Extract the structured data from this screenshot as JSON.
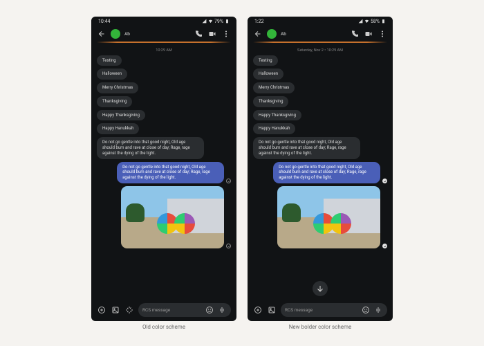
{
  "left": {
    "status": {
      "time": "10:44",
      "battery": "79%"
    },
    "header": {
      "contact_name": "Ab"
    },
    "timestamp": "10:29 AM",
    "incoming": [
      "Testing",
      "Halloween",
      "Merry Christmas",
      "Thanksgiving",
      "Happy Thanksgiving",
      "Happy Hanukkah",
      "Do not go gentle into that good night, Old age should burn and rave at close of day; Rage, rage against the dying of the light."
    ],
    "outgoing": "Do not go gentle into that good night, Old age should burn and rave at close of day; Rage, rage against the dying of the light.",
    "composer": {
      "placeholder": "RCS message"
    },
    "caption": "Old color scheme"
  },
  "right": {
    "status": {
      "time": "1:22",
      "battery": "58%"
    },
    "header": {
      "contact_name": "Ab"
    },
    "timestamp": "Saturday, Nov 2 • 10:29 AM",
    "incoming": [
      "Testing",
      "Halloween",
      "Merry Christmas",
      "Thanksgiving",
      "Happy Thanksgiving",
      "Happy Hanukkah",
      "Do not go gentle into that good night, Old age should burn and rave at close of day; Rage, rage against the dying of the light."
    ],
    "outgoing": "Do not go gentle into that good night, Old age should burn and rave at close of day; Rage, rage against the dying of the light.",
    "composer": {
      "placeholder": "RCS message"
    },
    "caption": "New bolder color scheme"
  }
}
